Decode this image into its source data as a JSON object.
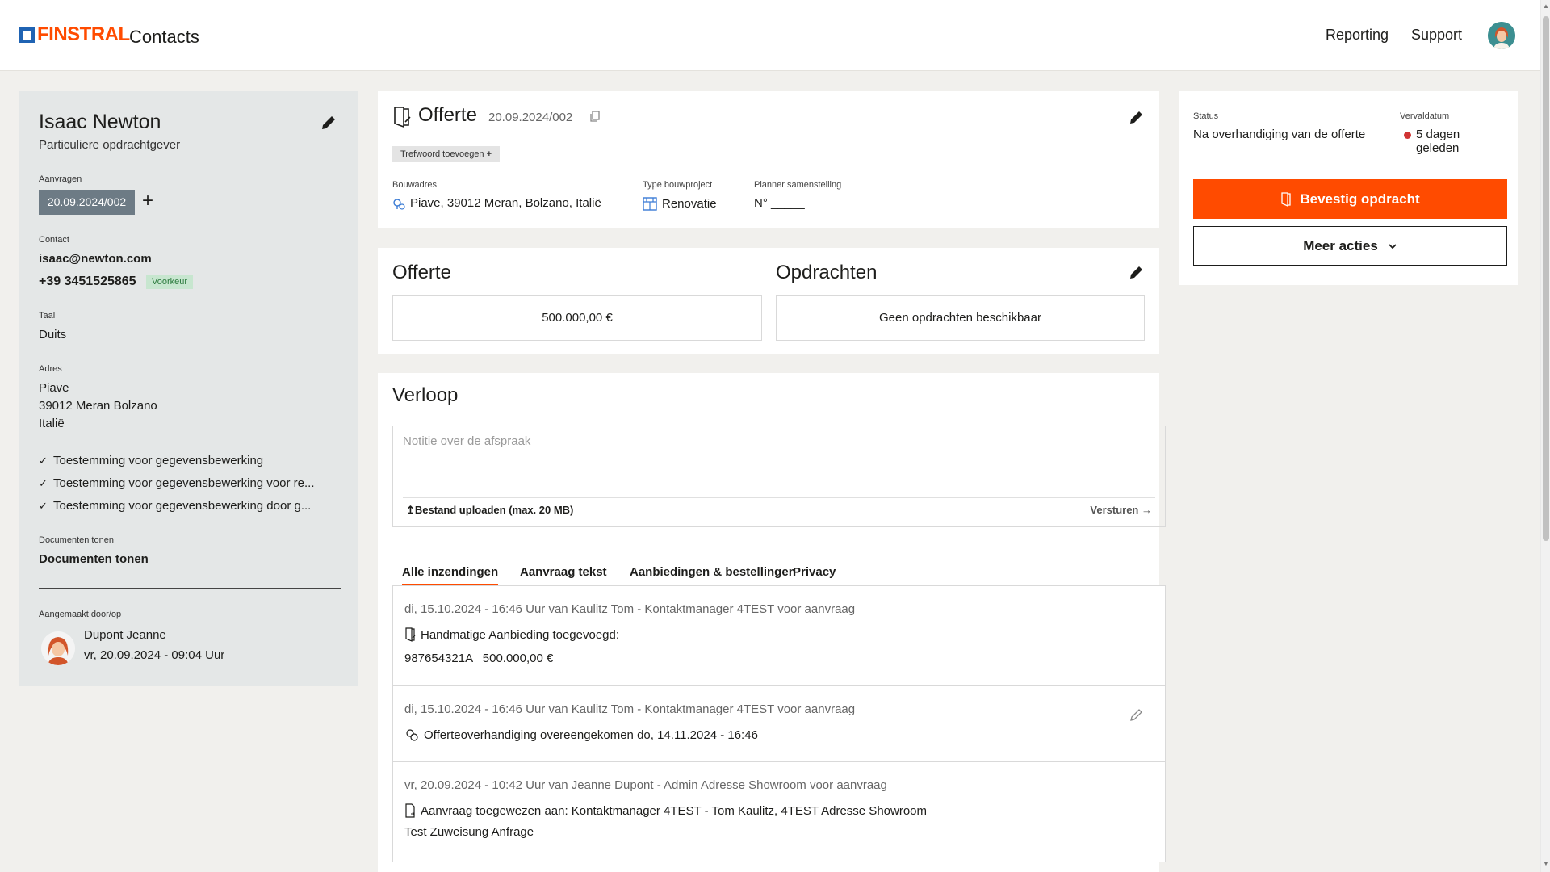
{
  "header": {
    "logo": "FINSTRAL",
    "app_name": "Contacts",
    "nav": [
      "Reporting",
      "Support"
    ]
  },
  "contact": {
    "name": "Isaac Newton",
    "type": "Particuliere opdrachtgever",
    "requests_label": "Aanvragen",
    "request_chip": "20.09.2024/002",
    "contact_label": "Contact",
    "email": "isaac@newton.com",
    "phone": "+39 3451525865",
    "preferred_badge": "Voorkeur",
    "language_label": "Taal",
    "language": "Duits",
    "address_label": "Adres",
    "address_lines": [
      "Piave",
      "39012 Meran Bolzano",
      "Italië"
    ],
    "consents": [
      "Toestemming voor gegevensbewerking",
      "Toestemming voor gegevensbewerking voor re...",
      "Toestemming voor gegevensbewerking door g..."
    ],
    "documents_label": "Documenten tonen",
    "documents_link": "Documenten tonen",
    "created_label": "Aangemaakt door/op",
    "created_by": "Dupont Jeanne",
    "created_at": "vr, 20.09.2024 - 09:04 Uur"
  },
  "offer": {
    "title": "Offerte",
    "number": "20.09.2024/002",
    "tag_button": "Trefwoord toevoegen",
    "address_label": "Bouwadres",
    "address": "Piave, 39012 Meran, Bolzano, Italië",
    "project_type_label": "Type bouwproject",
    "project_type": "Renovatie",
    "planner_label": "Planner samenstelling",
    "planner": "N° _____"
  },
  "summary": {
    "offer_title": "Offerte",
    "offer_amount": "500.000,00 €",
    "orders_title": "Opdrachten",
    "orders_value": "Geen opdrachten beschikbaar"
  },
  "status": {
    "status_label": "Status",
    "status_value": "Na overhandiging van de offerte",
    "due_label": "Vervaldatum",
    "due_value_1": "5 dagen",
    "due_value_2": "geleden",
    "confirm_button": "Bevestig opdracht",
    "more_button": "Meer acties",
    "due_dot_color": "#d03434",
    "accent_color": "#ff4b00"
  },
  "history": {
    "title": "Verloop",
    "note_placeholder": "Notitie over de afspraak",
    "upload_label": "Bestand uploaden (max. 20 MB)",
    "send_label": "Versturen",
    "tabs": [
      "Alle inzendingen",
      "Aanvraag tekst",
      "Aanbiedingen & bestellingen",
      "Privacy"
    ],
    "entries": [
      {
        "meta": "di, 15.10.2024 - 16:46 Uur van Kaulitz Tom - Kontaktmanager 4TEST voor aanvraag",
        "line1": "Handmatige Aanbieding toegevoegd:",
        "line2": "987654321A   500.000,00 €"
      },
      {
        "meta": "di, 15.10.2024 - 16:46 Uur van Kaulitz Tom - Kontaktmanager 4TEST voor aanvraag",
        "line1": "Offerteoverhandiging overeengekomen do, 14.11.2024 - 16:46"
      },
      {
        "meta": "vr, 20.09.2024 - 10:42 Uur van Jeanne Dupont - Admin Adresse Showroom voor aanvraag",
        "line1": "Aanvraag toegewezen aan: Kontaktmanager 4TEST - Tom Kaulitz, 4TEST Adresse Showroom",
        "line2": "Test Zuweisung Anfrage"
      }
    ]
  }
}
